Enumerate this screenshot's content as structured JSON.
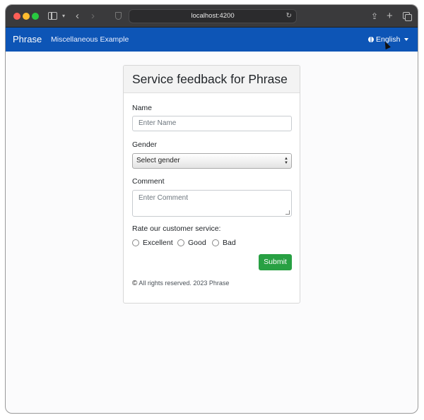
{
  "browser": {
    "url": "localhost:4200"
  },
  "navbar": {
    "brand": "Phrase",
    "link": "Miscellaneous Example",
    "language": "English"
  },
  "form": {
    "title": "Service feedback for Phrase",
    "name_label": "Name",
    "name_placeholder": "Enter Name",
    "gender_label": "Gender",
    "gender_selected": "Select gender",
    "comment_label": "Comment",
    "comment_placeholder": "Enter Comment",
    "rating_label": "Rate our customer service:",
    "rating_options": [
      "Excellent",
      "Good",
      "Bad"
    ],
    "submit_label": "Submit",
    "footer": "All rights reserved. 2023 Phrase"
  },
  "colors": {
    "navbar": "#0d55b6",
    "submit": "#28a043"
  }
}
